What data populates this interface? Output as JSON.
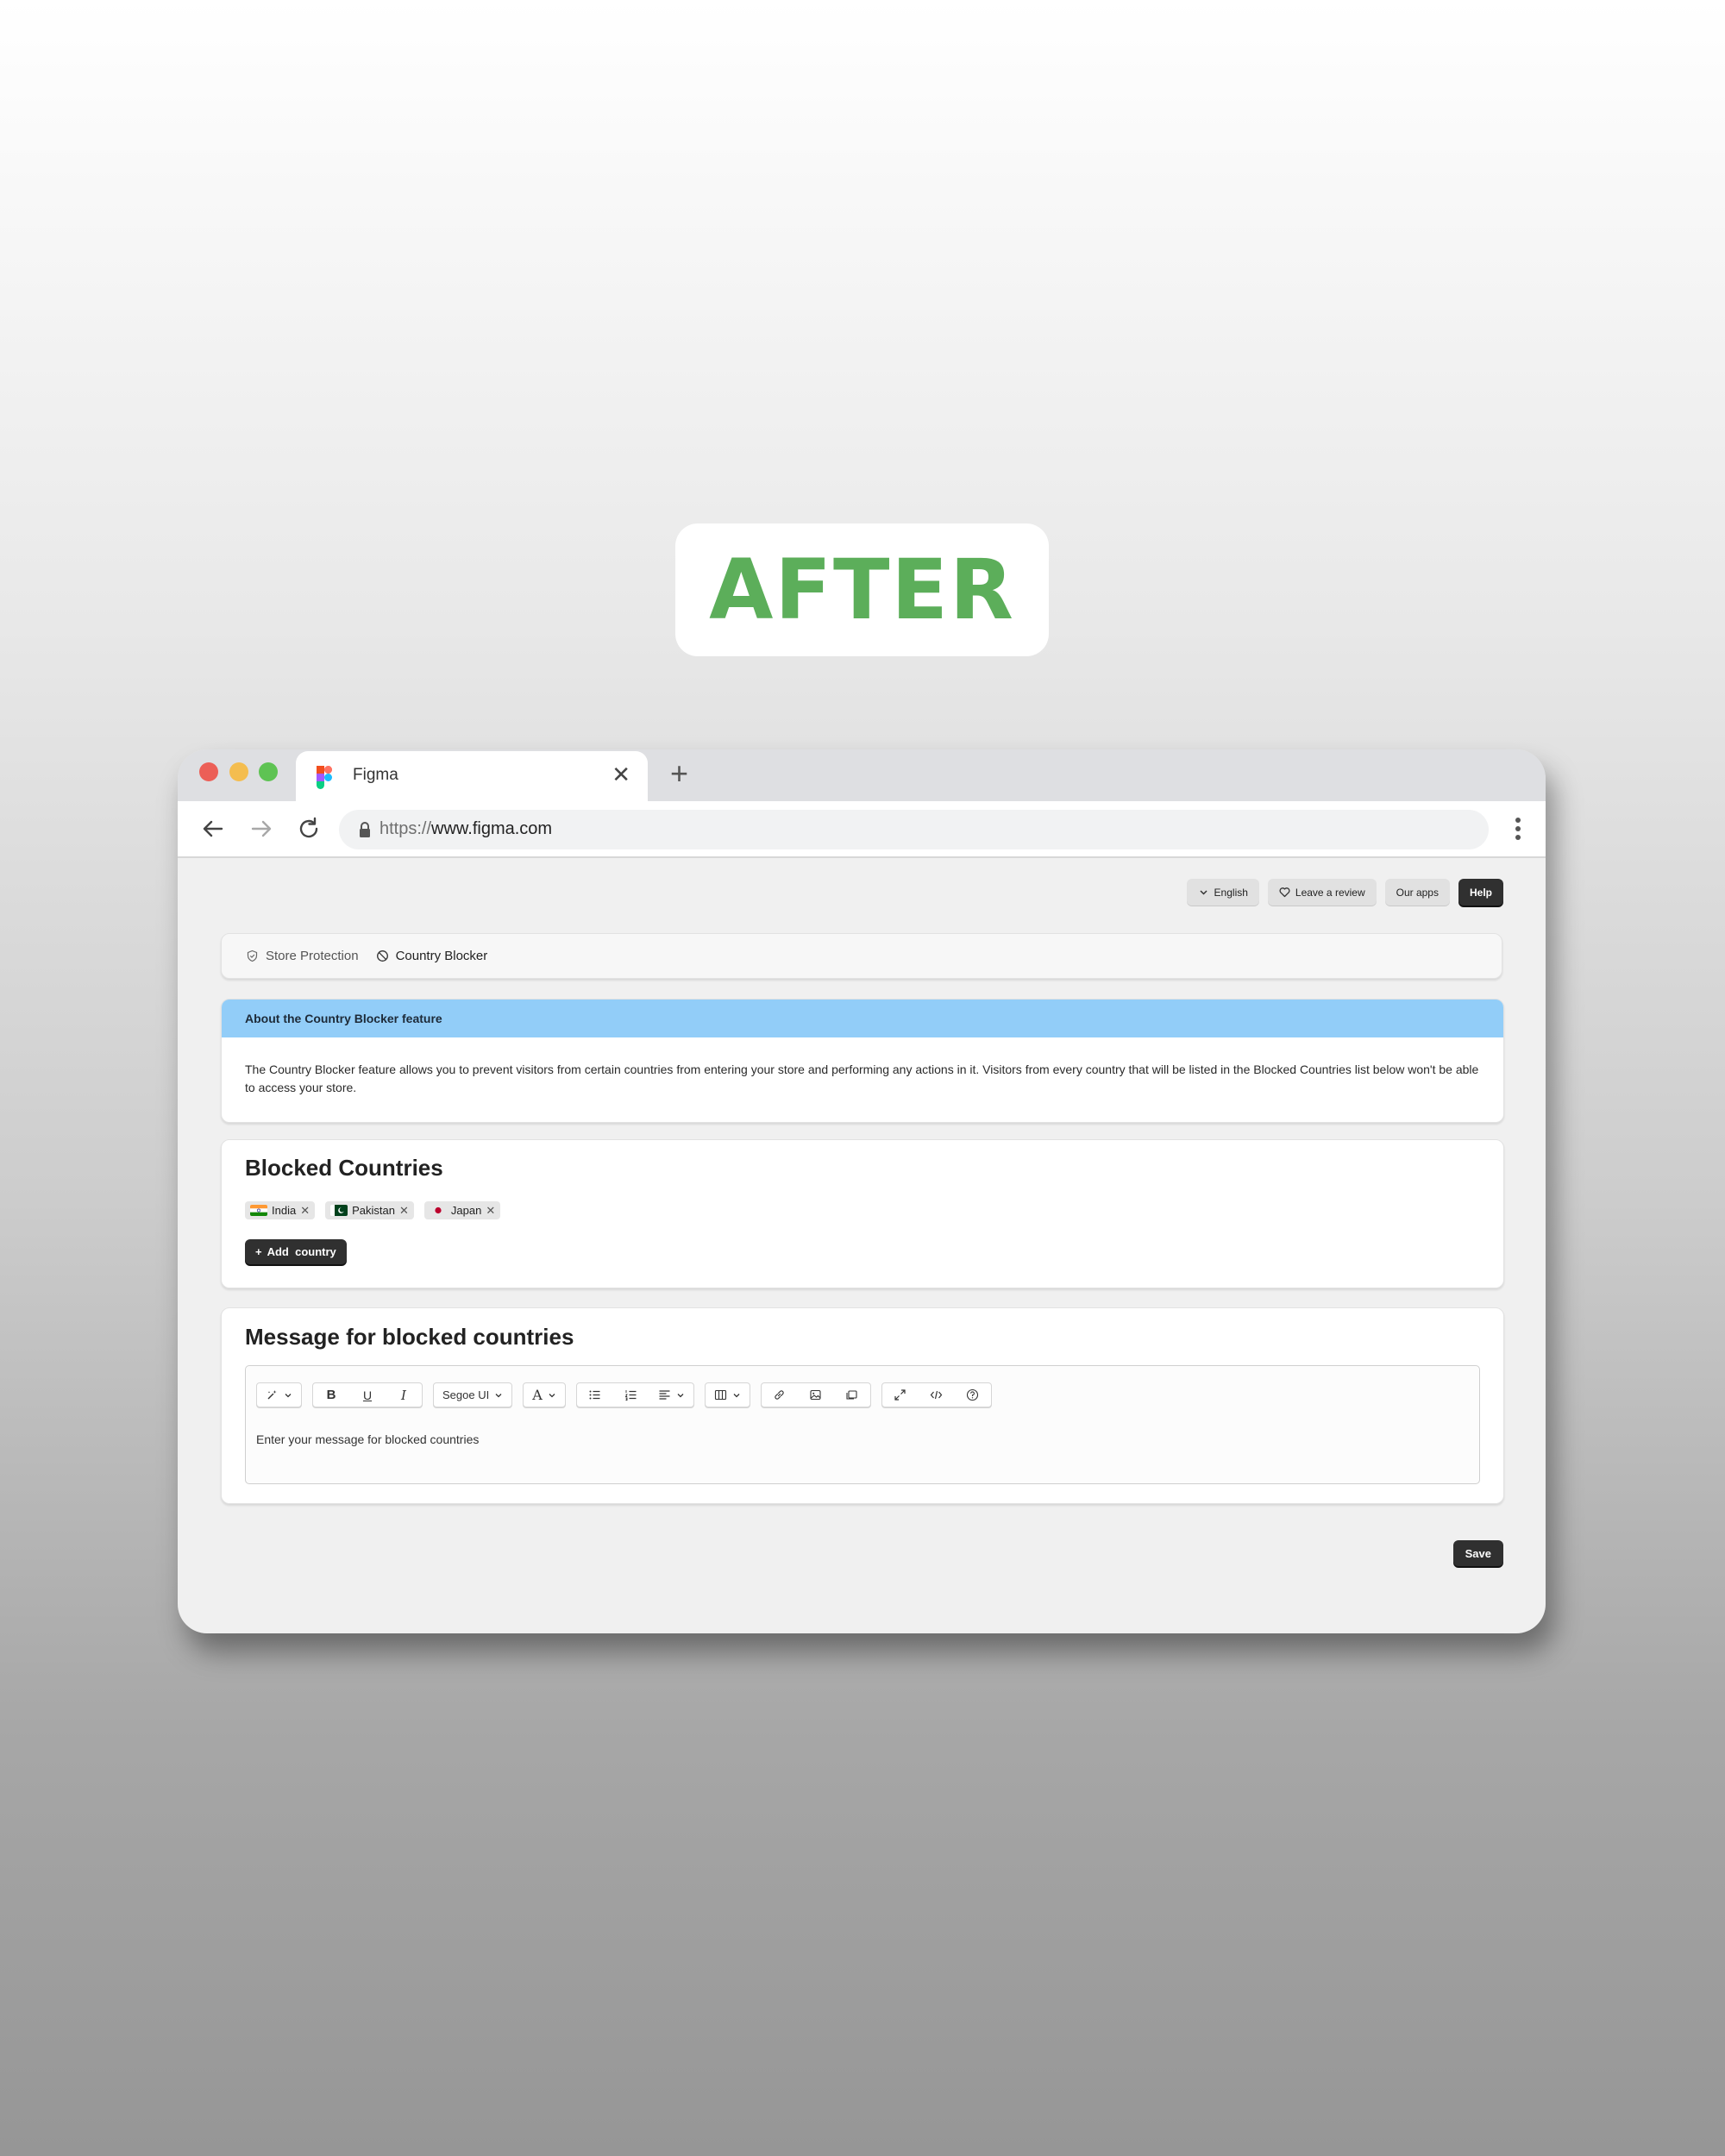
{
  "badge": {
    "label": "AFTER",
    "color": "#5cae5a"
  },
  "browser": {
    "tab_title": "Figma",
    "url_scheme": "https://",
    "url_host": "www.figma.com",
    "icons": [
      "back-arrow-icon",
      "forward-arrow-icon",
      "reload-icon",
      "lock-icon",
      "kebab-menu-icon",
      "close-icon",
      "plus-icon"
    ]
  },
  "header_buttons": {
    "language": "English",
    "review": "Leave a review",
    "apps": "Our apps",
    "help": "Help"
  },
  "breadcrumb": {
    "items": [
      {
        "label": "Store Protection",
        "icon": "shield-icon"
      },
      {
        "label": "Country Blocker",
        "icon": "block-icon"
      }
    ]
  },
  "about": {
    "title": "About the Country Blocker feature",
    "header_color": "#92cdf8",
    "body": "The Country Blocker feature allows you to prevent visitors from certain countries from entering your store and performing any actions in it. Visitors from every country that will be listed in the Blocked Countries list below won't be able to access your store."
  },
  "blocked": {
    "title": "Blocked Countries",
    "countries": [
      {
        "name": "India",
        "flag": "india-flag-icon"
      },
      {
        "name": "Pakistan",
        "flag": "pakistan-flag-icon"
      },
      {
        "name": "Japan",
        "flag": "japan-flag-icon"
      }
    ],
    "add_label": "Add  country"
  },
  "message": {
    "title": "Message for blocked countries",
    "font": "Segoe UI",
    "placeholder": "Enter your message for blocked countries"
  },
  "save_label": "Save"
}
